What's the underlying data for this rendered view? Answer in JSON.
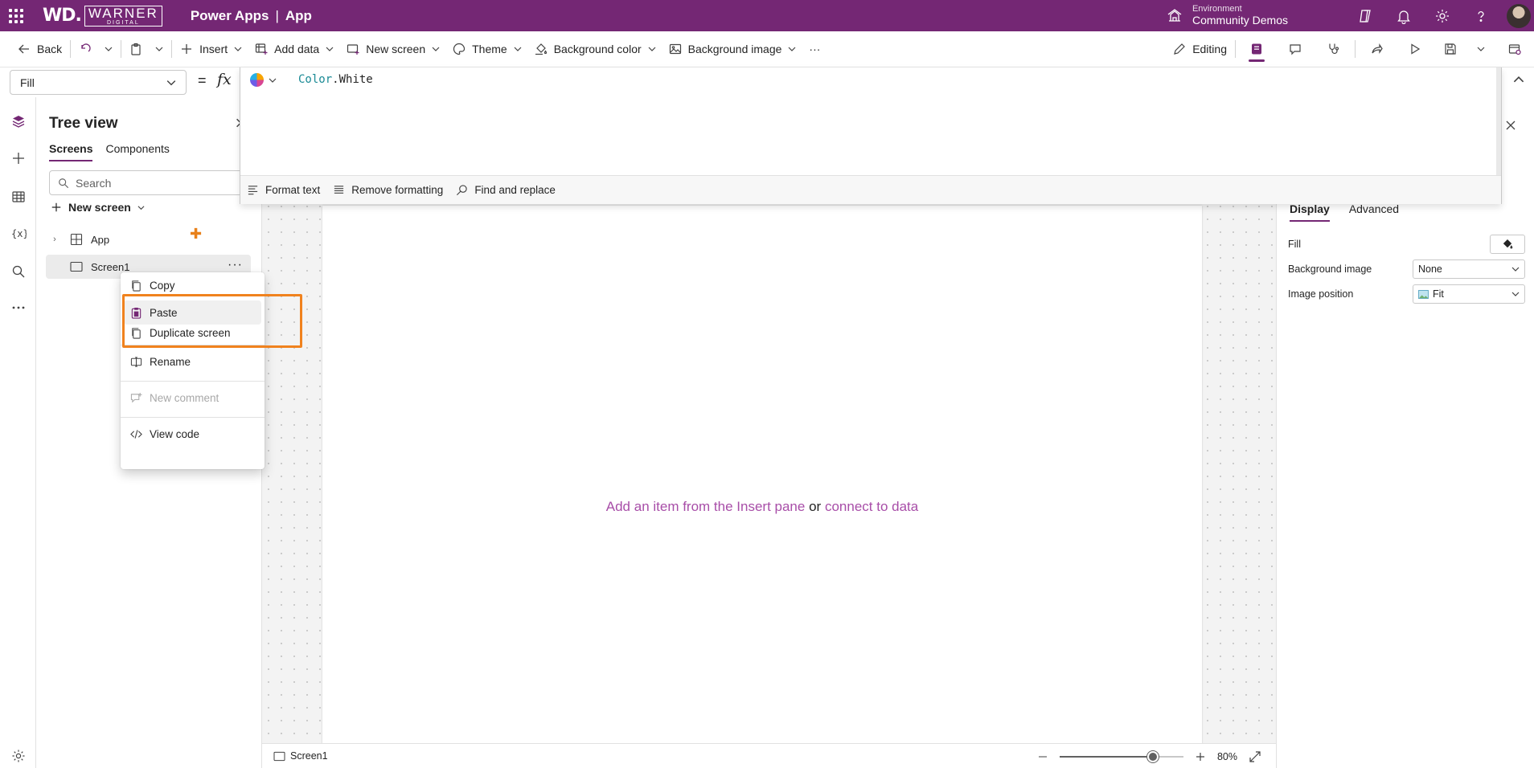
{
  "header": {
    "logo_wd": "WD.",
    "logo_warner": "WARNER",
    "logo_digital": "DIGITAL",
    "product": "Power Apps",
    "separator": "|",
    "app_name": "App",
    "environment_label": "Environment",
    "environment_name": "Community Demos",
    "accent_color": "#742774"
  },
  "commandbar": {
    "back": "Back",
    "insert": "Insert",
    "add_data": "Add data",
    "new_screen": "New screen",
    "theme": "Theme",
    "background_color": "Background color",
    "background_image": "Background image",
    "more": "···",
    "editing": "Editing"
  },
  "formula": {
    "property": "Fill",
    "equals": "=",
    "fx": "fx",
    "object": "Color",
    "dot": ".",
    "member": "White",
    "format_text": "Format text",
    "remove_formatting": "Remove formatting",
    "find_replace": "Find and replace"
  },
  "tree": {
    "title": "Tree view",
    "tabs": [
      "Screens",
      "Components"
    ],
    "search_placeholder": "Search",
    "new_screen": "New screen",
    "items": [
      {
        "label": "App"
      },
      {
        "label": "Screen1"
      }
    ]
  },
  "context_menu": {
    "items": [
      {
        "label": "Copy",
        "icon": "copy-icon"
      },
      {
        "label": "Paste",
        "icon": "paste-icon"
      },
      {
        "label": "Duplicate screen",
        "icon": "duplicate-icon"
      },
      {
        "label": "Rename",
        "icon": "rename-icon"
      },
      {
        "label": "New comment",
        "icon": "comment-icon",
        "disabled": true
      },
      {
        "label": "View code",
        "icon": "code-icon"
      }
    ],
    "highlight_color": "#f0821e"
  },
  "canvas": {
    "hint_part1": "Add an item from the Insert pane",
    "hint_or": "or",
    "hint_part2": "connect to data"
  },
  "bottombar": {
    "screen_name": "Screen1",
    "zoom": "80%",
    "zoom_fraction": 0.8
  },
  "properties": {
    "tabs": [
      "Display",
      "Advanced"
    ],
    "fill_label": "Fill",
    "background_image_label": "Background image",
    "background_image_value": "None",
    "image_position_label": "Image position",
    "image_position_value": "Fit"
  }
}
